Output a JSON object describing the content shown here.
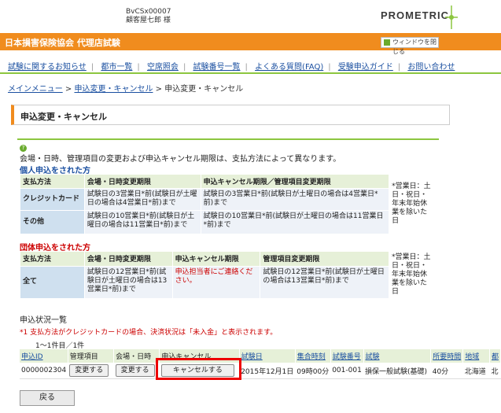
{
  "header": {
    "user_id": "BvCSx00007",
    "user_name": "顧客屋七郎 様",
    "logo": "PROMETRIC"
  },
  "orange_bar": {
    "title": "日本損害保険協会 代理店試験",
    "close_window": "ウィンドウを閉じる"
  },
  "menu": [
    "試験に関するお知らせ",
    "都市一覧",
    "空席照会",
    "試験番号一覧",
    "よくある質問(FAQ)",
    "受験申込ガイド",
    "お問い合わせ"
  ],
  "breadcrumb": {
    "menu": "メインメニュー",
    "change": "申込変更・キャンセル",
    "sep": ">",
    "current": "申込変更・キャンセル"
  },
  "page_title": "申込変更・キャンセル",
  "note": "会場・日時、管理項目の変更および申込キャンセル期限は、支払方法によって異なります。",
  "individual": {
    "heading": "個人申込をされた方",
    "headers": [
      "支払方法",
      "会場・日時変更期限",
      "申込キャンセル期限／管理項目変更期限"
    ],
    "rows": [
      {
        "method": "クレジットカード",
        "change": "試験日の3営業日*前(試験日が土曜日の場合は4営業日*前)まで",
        "cancel": "試験日の3営業日*前(試験日が土曜日の場合は4営業日*前)まで"
      },
      {
        "method": "その他",
        "change": "試験日の10営業日*前(試験日が土曜日の場合は11営業日*前)まで",
        "cancel": "試験日の10営業日*前(試験日が土曜日の場合は11営業日*前)まで"
      }
    ],
    "side_note": "*営業日：土日・祝日・年末年始休業を除いた日"
  },
  "group": {
    "heading": "団体申込をされた方",
    "headers": [
      "支払方法",
      "会場・日時変更期限",
      "申込キャンセル期限",
      "管理項目変更期限"
    ],
    "row": {
      "method": "全て",
      "change": "試験日の12営業日*前(試験日が土曜日の場合は13営業日*前)まで",
      "cancel": "申込担当者にご連絡ください。",
      "manage": "試験日の12営業日*前(試験日が土曜日の場合は13営業日*前)まで"
    },
    "side_note": "*営業日：土日・祝日・年末年始休業を除いた日"
  },
  "status": {
    "heading": "申込状況一覧",
    "note": "*1 支払方法がクレジットカードの場合、決済状況は「未入金」と表示されます。",
    "count": "1～1件目／1件",
    "columns": [
      "申込ID",
      "管理項目",
      "会場・日時",
      "申込キャンセル",
      "試験日",
      "集合時刻",
      "試験番号",
      "試験",
      "所要時間",
      "地域",
      "都"
    ],
    "row": {
      "id": "0000002304",
      "manage_btn": "変更する",
      "venue_btn": "変更する",
      "cancel_btn": "キャンセルする",
      "date": "2015年12月1日",
      "time": "09時00分",
      "exam_no": "001-001",
      "exam": "損保一般試験(基礎)",
      "duration": "40分",
      "region": "北海道",
      "city": "北"
    }
  },
  "back_label": "戻る"
}
